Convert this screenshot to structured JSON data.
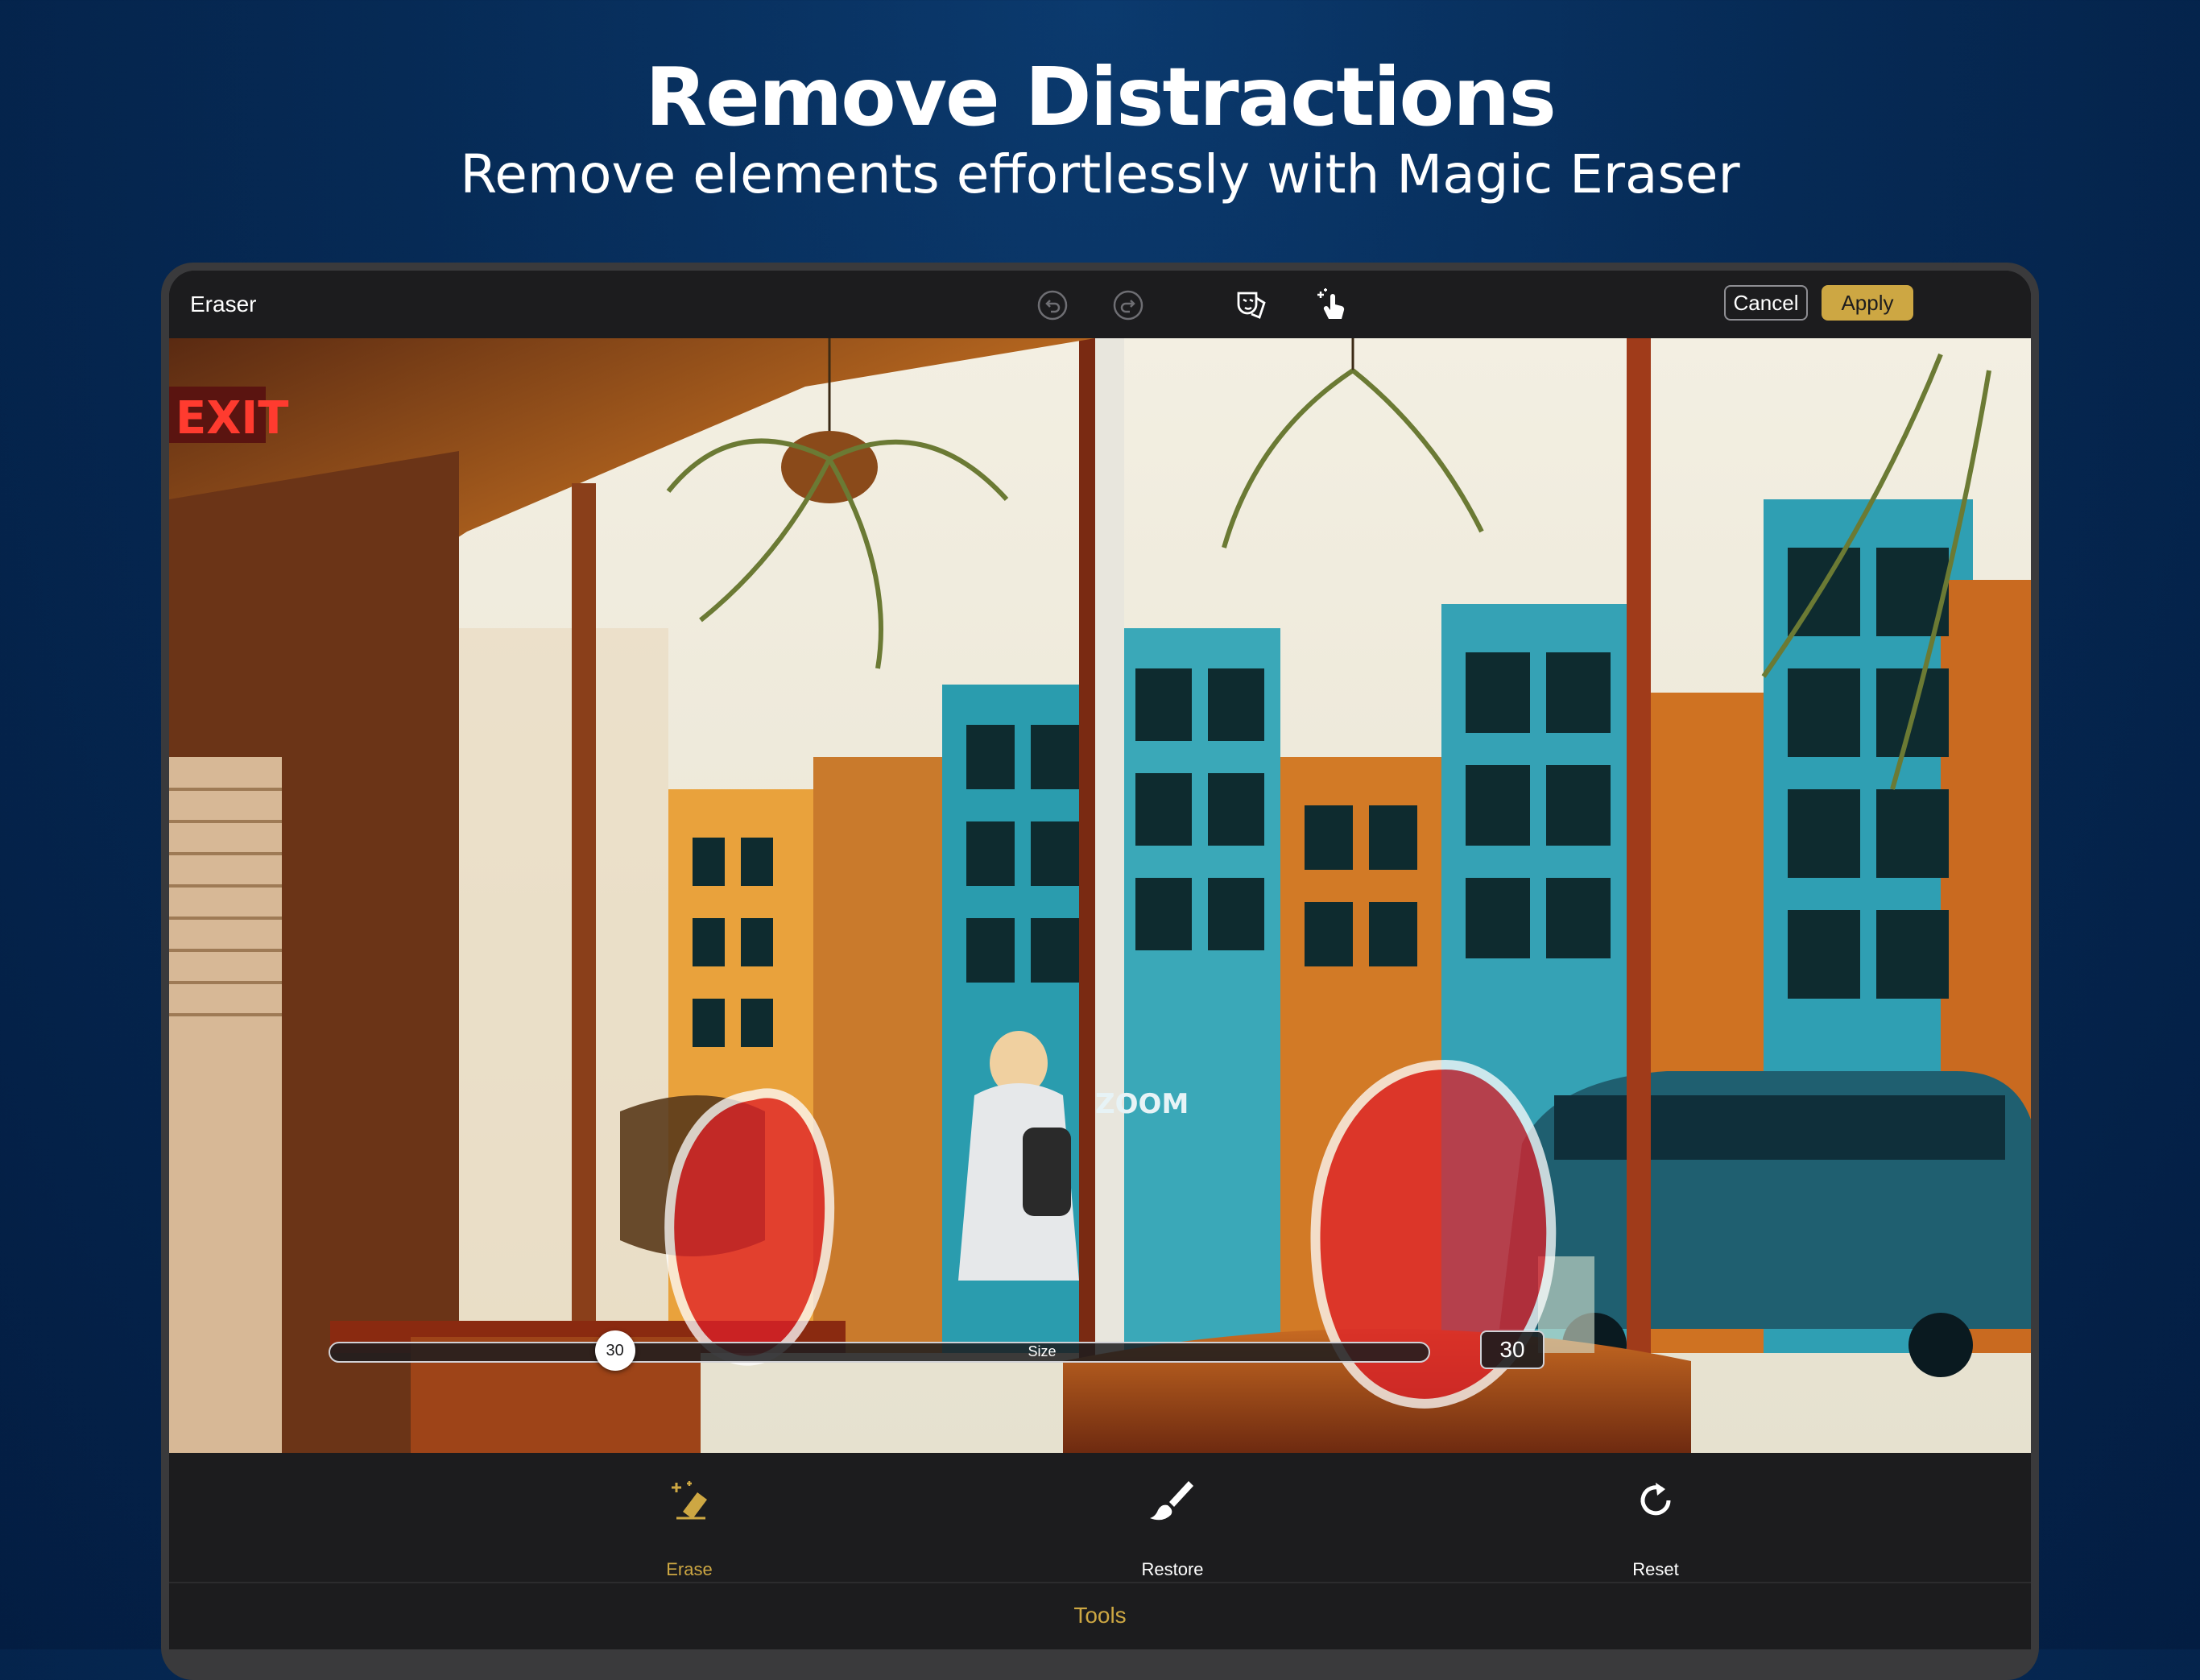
{
  "marketing": {
    "headline": "Remove Distractions",
    "subheadline": "Remove elements effortlessly with Magic Eraser"
  },
  "app": {
    "title": "Eraser",
    "cancel_label": "Cancel",
    "apply_label": "Apply",
    "icons": {
      "undo": "undo-icon",
      "redo": "redo-icon",
      "compare": "mask-compare-icon",
      "auto": "magic-tap-icon"
    }
  },
  "canvas": {
    "sign_text": "EXIT",
    "storefront_text": "ZOOM"
  },
  "slider": {
    "label": "Size",
    "value": "30",
    "value_box": "30",
    "fraction": 0.26
  },
  "tools": {
    "items": [
      {
        "label": "Erase",
        "icon": "eraser-sparkle-icon",
        "active": true
      },
      {
        "label": "Restore",
        "icon": "brush-icon",
        "active": false
      },
      {
        "label": "Reset",
        "icon": "reset-icon",
        "active": false
      }
    ],
    "section_label": "Tools"
  },
  "colors": {
    "accent": "#cda743",
    "background": "#062a55",
    "toolbar": "#1c1c1e",
    "erase_mask": "#e0202a"
  }
}
